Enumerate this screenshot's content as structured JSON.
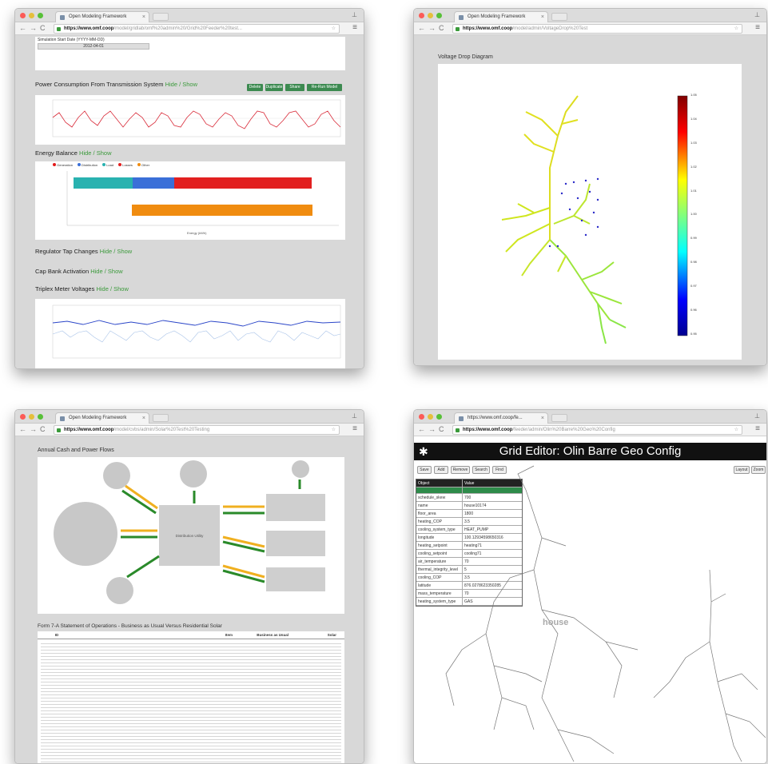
{
  "windows": {
    "w1": {
      "tab": "Open Modeling Framework",
      "url_domain": "https://www.omf.coop",
      "url_path": "/model/gridlab/omf%20admin%20/Grid%20Feeder%20test..."
    },
    "w2": {
      "tab": "Open Modeling Framework",
      "url_domain": "https://www.omf.coop",
      "url_path": "/model/admin/VoltageDrop%20Test"
    },
    "w3": {
      "tab": "Open Modeling Framework",
      "url_domain": "https://www.omf.coop",
      "url_path": "/model/cvbs/admin/Solar%20Test%20Testing"
    },
    "w4": {
      "tab": "https://www.omf.coop/fe...",
      "url_domain": "https://www.omf.coop",
      "url_path": "/feeder/admin/Olin%20Barre%20Geo%20Config"
    }
  },
  "gridlab": {
    "sim_start_label": "Simulation Start Date (YYYY-MM-DD)",
    "sim_start_value": "2012-04-01",
    "buttons": [
      "Delete",
      "Duplicate",
      "Share",
      "Re-Run Model"
    ],
    "sections": [
      {
        "title": "Power Consumption From Transmission System",
        "toggle": "Hide / Show"
      },
      {
        "title": "Energy Balance",
        "toggle": "Hide / Show"
      },
      {
        "title": "Regulator Tap Changes",
        "toggle": "Hide / Show"
      },
      {
        "title": "Cap Bank Activation",
        "toggle": "Hide / Show"
      },
      {
        "title": "Triplex Meter Voltages",
        "toggle": "Hide / Show"
      }
    ],
    "energy_legend": [
      {
        "name": "Generation",
        "color": "#e21a1a"
      },
      {
        "name": "Distribution",
        "color": "#3a6fd8"
      },
      {
        "name": "Load",
        "color": "#29b2b0"
      },
      {
        "name": "Losses",
        "color": "#e22020"
      },
      {
        "name": "Other",
        "color": "#f08c10"
      }
    ],
    "xaxis_label": "Energy (kWh)"
  },
  "voltage": {
    "title": "Voltage Drop Diagram",
    "colorbar_ticks": [
      "1.05",
      "1.04",
      "1.03",
      "1.02",
      "1.01",
      "1.00",
      "0.99",
      "0.98",
      "0.97",
      "0.96",
      "0.95"
    ]
  },
  "cashflow": {
    "title": "Annual Cash and Power Flows",
    "table_title": "Form 7-A Statement of Operations - Business as Usual Versus Residential Solar",
    "table_headers": [
      "ID",
      "Item",
      "Business as Usual",
      "Solar"
    ],
    "center_label": "Distribution Utility"
  },
  "grideditor": {
    "title": "Grid Editor: Olin Barre Geo Config",
    "toolbar_left": [
      "Save",
      "Add",
      "Remove",
      "Search",
      "Find"
    ],
    "toolbar_right": [
      "Layout",
      "Zoom"
    ],
    "table_header": [
      "Object",
      "Value"
    ],
    "rows": [
      [
        "schedule_skew",
        "700"
      ],
      [
        "name",
        "house10174"
      ],
      [
        "floor_area",
        "1800"
      ],
      [
        "heating_COP",
        "3.5"
      ],
      [
        "cooling_system_type",
        "HEAT_PUMP"
      ],
      [
        "longitude",
        "100.12934598650316"
      ],
      [
        "heating_setpoint",
        "heating71"
      ],
      [
        "cooling_setpoint",
        "cooling71"
      ],
      [
        "air_temperature",
        "70"
      ],
      [
        "thermal_integrity_level",
        "5"
      ],
      [
        "cooling_COP",
        "3.5"
      ],
      [
        "latitude",
        "876.0278623350285"
      ],
      [
        "mass_temperature",
        "70"
      ],
      [
        "heating_system_type",
        "GAS"
      ]
    ],
    "map_label": "house"
  }
}
